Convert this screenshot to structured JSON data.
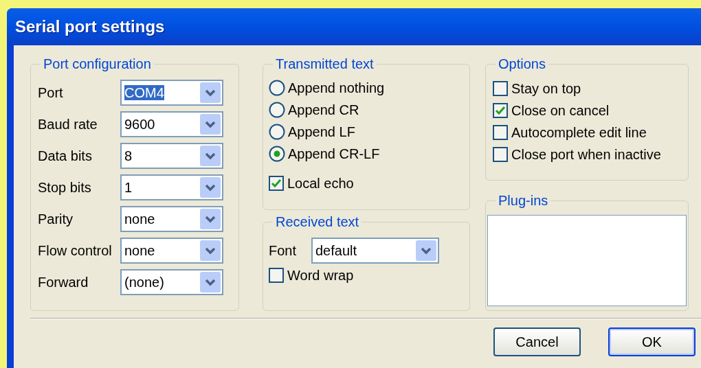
{
  "window": {
    "title": "Serial port settings"
  },
  "port_configuration": {
    "title": "Port configuration",
    "fields": [
      {
        "label": "Port",
        "value": "COM4",
        "highlighted": true
      },
      {
        "label": "Baud rate",
        "value": "9600",
        "highlighted": false
      },
      {
        "label": "Data bits",
        "value": "8",
        "highlighted": false
      },
      {
        "label": "Stop bits",
        "value": "1",
        "highlighted": false
      },
      {
        "label": "Parity",
        "value": "none",
        "highlighted": false
      },
      {
        "label": "Flow control",
        "value": "none",
        "highlighted": false
      },
      {
        "label": "Forward",
        "value": "(none)",
        "highlighted": false
      }
    ]
  },
  "transmitted_text": {
    "title": "Transmitted text",
    "options": [
      {
        "label": "Append nothing",
        "selected": false
      },
      {
        "label": "Append CR",
        "selected": false
      },
      {
        "label": "Append LF",
        "selected": false
      },
      {
        "label": "Append CR-LF",
        "selected": true
      }
    ],
    "local_echo": {
      "label": "Local echo",
      "checked": true
    }
  },
  "received_text": {
    "title": "Received text",
    "font": {
      "label": "Font",
      "value": "default"
    },
    "word_wrap": {
      "label": "Word wrap",
      "checked": false
    }
  },
  "options": {
    "title": "Options",
    "items": [
      {
        "label": "Stay on top",
        "checked": false
      },
      {
        "label": "Close on cancel",
        "checked": true
      },
      {
        "label": "Autocomplete edit line",
        "checked": false
      },
      {
        "label": "Close port when inactive",
        "checked": false
      }
    ]
  },
  "plugins": {
    "title": "Plug-ins"
  },
  "buttons": [
    {
      "label": "Cancel",
      "default": false
    },
    {
      "label": "OK",
      "default": true
    }
  ]
}
